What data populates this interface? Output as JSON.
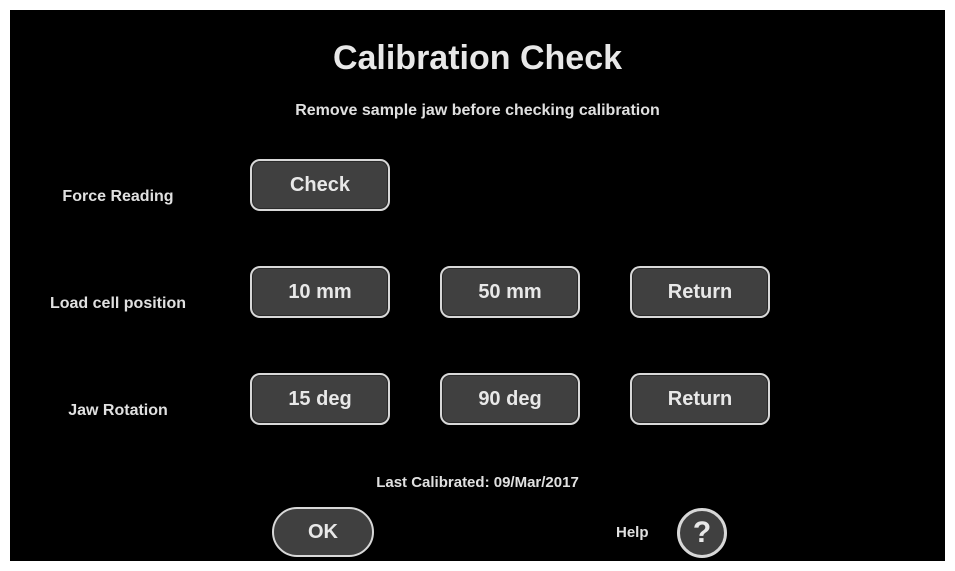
{
  "dialog": {
    "title": "Calibration Check",
    "instruction": "Remove sample jaw before checking calibration"
  },
  "force_reading": {
    "label": "Force Reading",
    "check_label": "Check"
  },
  "load_cell_position": {
    "label": "Load cell position",
    "btn_10mm": "10 mm",
    "btn_50mm": "50 mm",
    "return_label": "Return"
  },
  "jaw_rotation": {
    "label": "Jaw Rotation",
    "btn_15deg": "15 deg",
    "btn_90deg": "90 deg",
    "return_label": "Return"
  },
  "footer": {
    "last_calibrated": "Last Calibrated: 09/Mar/2017",
    "ok_label": "OK",
    "help_label": "Help",
    "help_icon": "?"
  },
  "colors": {
    "background": "#000000",
    "button_fill": "#404040",
    "button_border": "#d8d8d8",
    "text": "#e8e8e8"
  }
}
